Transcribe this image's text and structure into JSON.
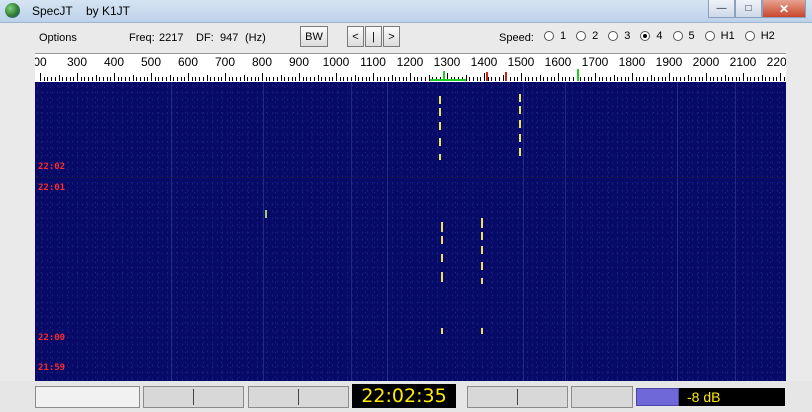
{
  "window": {
    "title": "SpecJT",
    "subtitle": "by K1JT",
    "minimize_icon": "minimize-icon",
    "maximize_icon": "maximize-icon",
    "close_icon": "close-icon",
    "minimize_glyph": "—",
    "maximize_glyph": "□",
    "close_glyph": "✕"
  },
  "toolbar": {
    "options_label": "Options",
    "freq_label": "Freq:",
    "freq_value": "2217",
    "df_label": "DF:",
    "df_value": "947",
    "df_unit": "(Hz)",
    "bw_button": "BW",
    "prev_button": "<",
    "center_button": "|",
    "next_button": ">",
    "speed_label": "Speed:",
    "speed_options": [
      "1",
      "2",
      "3",
      "4",
      "5",
      "H1",
      "H2"
    ],
    "speed_selected": "4"
  },
  "scale": {
    "labels": [
      "00",
      "300",
      "400",
      "500",
      "600",
      "700",
      "800",
      "900",
      "1000",
      "1100",
      "1200",
      "1300",
      "1400",
      "1500",
      "1600",
      "1700",
      "1800",
      "1900",
      "2000",
      "2100",
      "2200"
    ],
    "marker_colors": {
      "green": "#22cc22",
      "red": "#cc2222"
    }
  },
  "waterfall": {
    "background": "#070a66",
    "time_labels": [
      "22:02",
      "22:01",
      "22:00",
      "21:59"
    ],
    "time_label_color": "#ff2a2a"
  },
  "status": {
    "clock": "22:02:35",
    "level": "-8 dB",
    "clock_color": "#ffea00"
  }
}
